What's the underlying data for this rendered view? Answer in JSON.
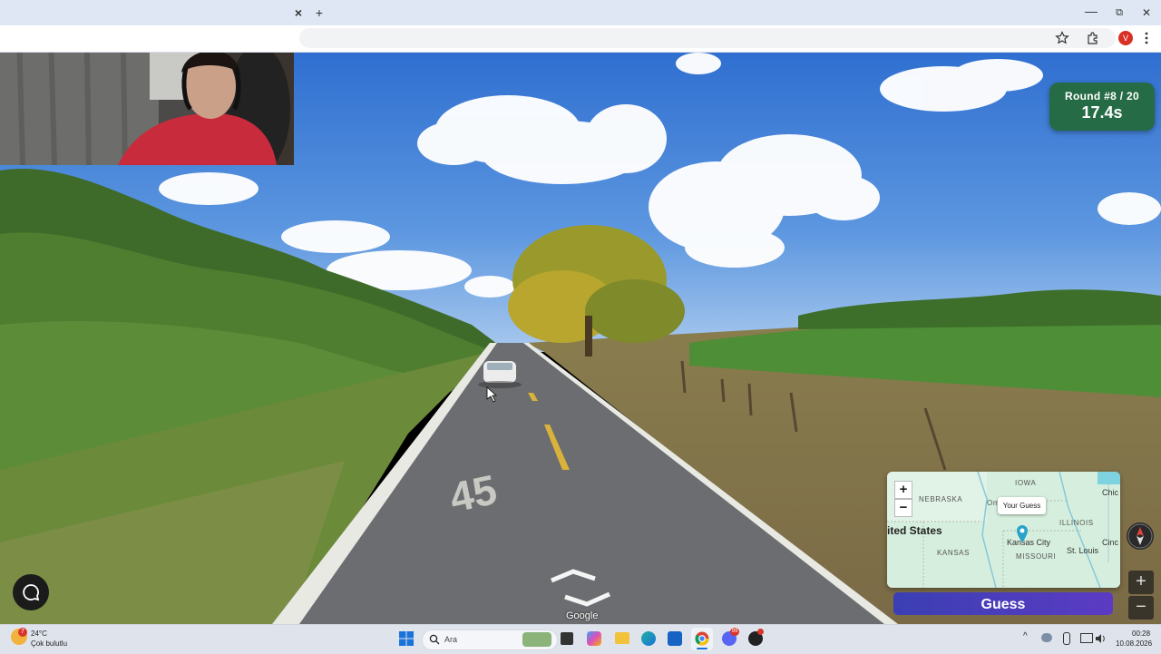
{
  "browser": {
    "close_tab_label": "×",
    "new_tab_label": "+",
    "window_controls": {
      "minimize": "—",
      "maximize": "⧉",
      "close": "✕"
    },
    "profile_initial": "V",
    "icons": [
      "star-icon",
      "extensions-icon",
      "avatar",
      "menu-icon"
    ]
  },
  "hud": {
    "round_label": "Round #8 / 20",
    "timer": "17.4s"
  },
  "minimap": {
    "zoom_in": "+",
    "zoom_out": "−",
    "labels": {
      "iowa": "IOWA",
      "nebraska": "NEBRASKA",
      "illinois": "ILLINOIS",
      "kansas": "KANSAS",
      "missouri": "MISSOURI",
      "united_states": "ited States",
      "kansas_city": "Kansas City",
      "st_louis": "St. Louis",
      "chicago": "Chic",
      "cincinnati": "Cinc",
      "omaha": "Om"
    },
    "tooltip": "Your Guess"
  },
  "guess_button": "Guess",
  "street_controls": {
    "zoom_in": "+",
    "zoom_out": "−"
  },
  "road_marking": "45",
  "watermark": "Google",
  "taskbar": {
    "weather_temp": "24°C",
    "weather_desc": "Çok bulutlu",
    "weather_badge": "7",
    "search_placeholder": "Ara",
    "time": "00:28",
    "date": "10.08.2026",
    "tray_chevron": "^",
    "discord_badge": "99"
  },
  "colors": {
    "hud_green": "#256b45",
    "guess_purple": "#4a3dbb",
    "sky": "#3f7fd6",
    "road": "#6b6d70"
  }
}
